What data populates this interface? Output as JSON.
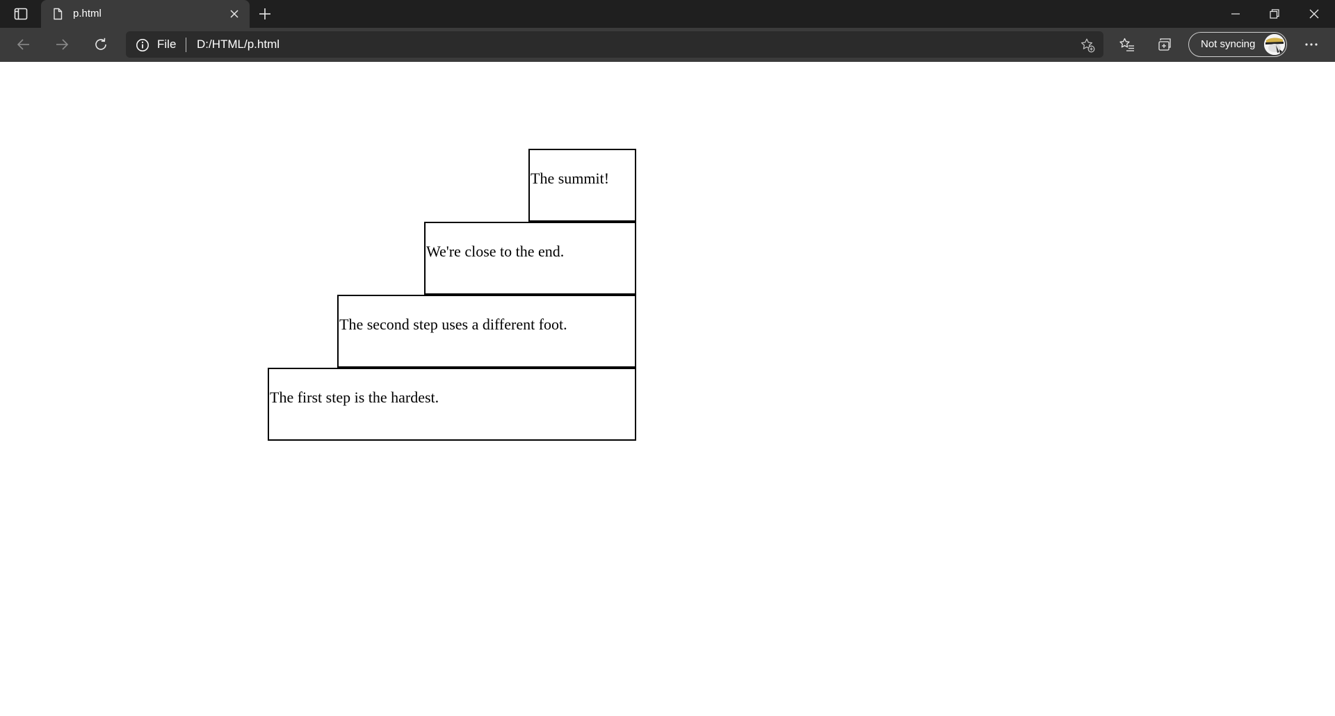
{
  "browser": {
    "tab": {
      "title": "p.html"
    },
    "omnibox": {
      "scheme_label": "File",
      "url": "D:/HTML/p.html"
    },
    "profile": {
      "sync_status": "Not syncing"
    }
  },
  "page": {
    "steps": [
      {
        "text": "The summit!"
      },
      {
        "text": "We're close to the end."
      },
      {
        "text": "The second step uses a different foot."
      },
      {
        "text": "The first step is the hardest."
      }
    ]
  }
}
